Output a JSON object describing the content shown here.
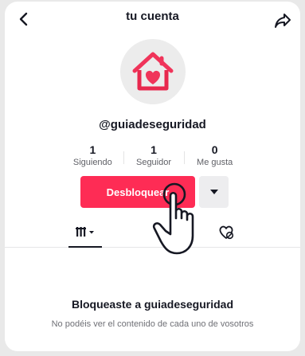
{
  "header": {
    "title": "tu cuenta",
    "back_icon": "chevron-left-icon",
    "share_icon": "share-arrow-icon"
  },
  "profile": {
    "avatar_icon": "heart-house-icon",
    "username": "@guiadeseguridad"
  },
  "stats": [
    {
      "value": "1",
      "label": "Siguiendo"
    },
    {
      "value": "1",
      "label": "Seguidor"
    },
    {
      "value": "0",
      "label": "Me gusta"
    }
  ],
  "actions": {
    "unblock_label": "Desbloquear",
    "more_icon": "caret-down-icon"
  },
  "tabs": {
    "grid_icon": "video-grid-icon",
    "liked_icon": "hidden-liked-icon"
  },
  "blocked": {
    "title": "Bloqueaste a guiadeseguridad",
    "subtitle": "No podéis ver el contenido de cada uno de vosotros"
  },
  "colors": {
    "accent": "#fe2c55",
    "text": "#161823",
    "muted": "#6f7076",
    "secondary_button": "#ededef"
  },
  "overlay": {
    "pointer_icon": "hand-pointer-icon"
  }
}
